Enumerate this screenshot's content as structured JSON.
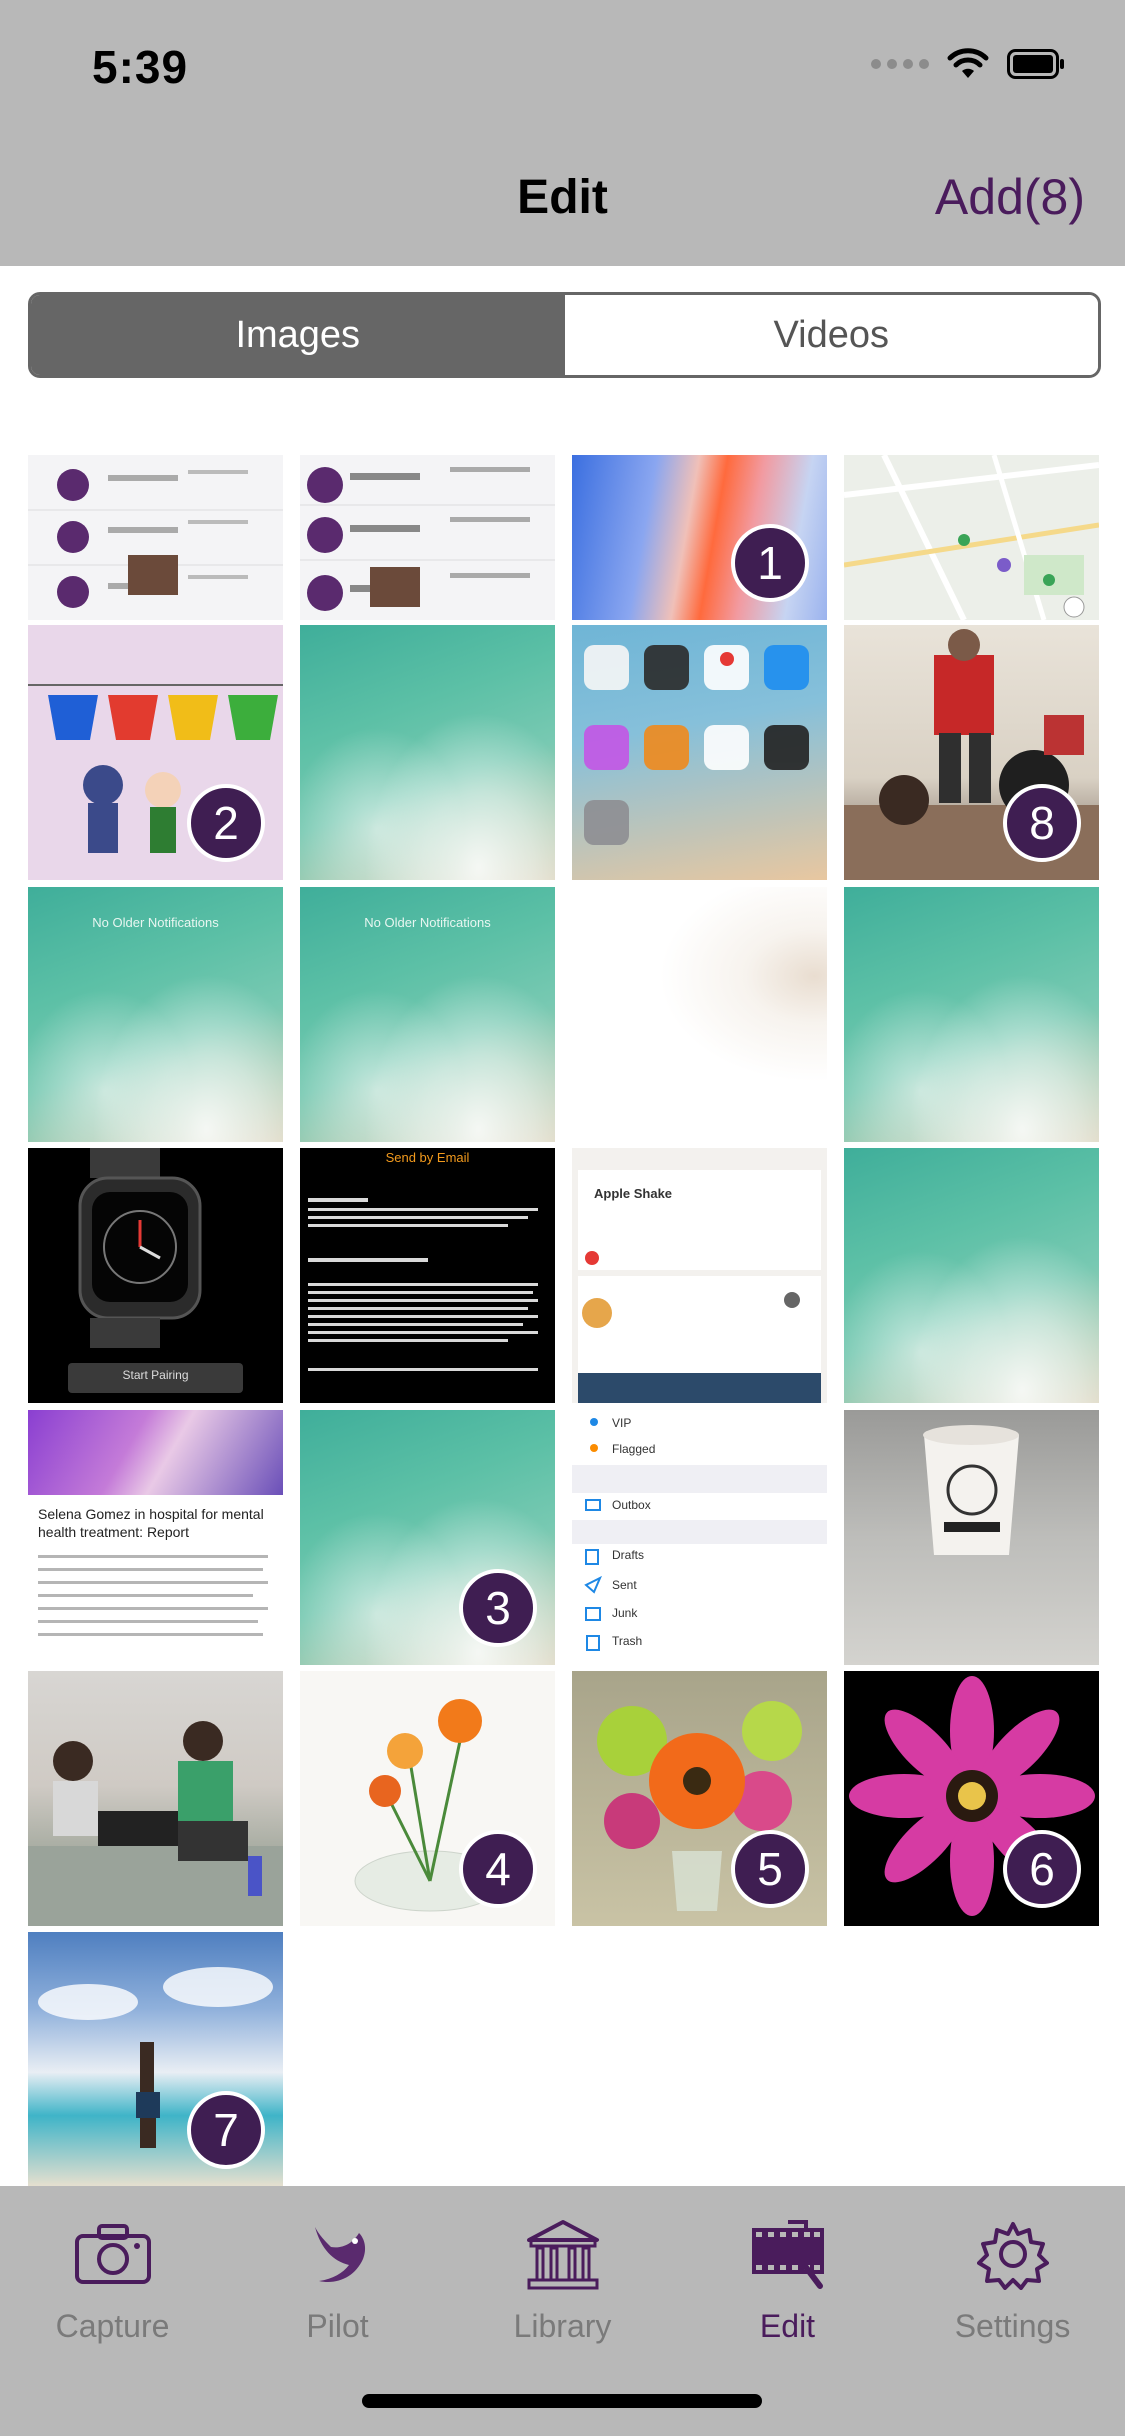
{
  "status": {
    "time": "5:39"
  },
  "nav": {
    "title": "Edit",
    "add_label": "Add(8)"
  },
  "segments": {
    "images": "Images",
    "videos": "Videos"
  },
  "grid": {
    "thumbs": [
      {
        "desc": "app-list-screenshot"
      },
      {
        "desc": "app-list-screenshot-2"
      },
      {
        "desc": "iphone-wallpaper",
        "badge": "1"
      },
      {
        "desc": "map-screenshot"
      },
      {
        "desc": "toys-and-cups",
        "badge": "2"
      },
      {
        "desc": "ocean-wallpaper"
      },
      {
        "desc": "home-screen"
      },
      {
        "desc": "office-people",
        "badge": "8"
      },
      {
        "desc": "ocean-notifications",
        "text": "No Older Notifications"
      },
      {
        "desc": "ocean-notifications-2",
        "text": "No Older Notifications"
      },
      {
        "desc": "blurred-white"
      },
      {
        "desc": "ocean-wallpaper-2"
      },
      {
        "desc": "apple-watch",
        "text": "Start Pairing"
      },
      {
        "desc": "watch-terms",
        "text": "Send by Email"
      },
      {
        "desc": "apple-shake",
        "text": "Apple Shake"
      },
      {
        "desc": "ocean-wallpaper-3"
      },
      {
        "desc": "news-article",
        "text": "Selena Gomez in hospital for mental health treatment: Report"
      },
      {
        "desc": "ocean-wallpaper-4",
        "badge": "3"
      },
      {
        "desc": "mail-folders",
        "items": [
          "VIP",
          "Flagged",
          "Outbox",
          "Drafts",
          "Sent",
          "Junk",
          "Trash"
        ]
      },
      {
        "desc": "coffee-cup"
      },
      {
        "desc": "people-laptops"
      },
      {
        "desc": "flower-vase",
        "badge": "4"
      },
      {
        "desc": "flower-bouquet",
        "badge": "5"
      },
      {
        "desc": "pink-flower",
        "badge": "6"
      },
      {
        "desc": "beach-handstand",
        "badge": "7"
      }
    ]
  },
  "tabs": [
    {
      "label": "Capture",
      "icon": "camera-icon"
    },
    {
      "label": "Pilot",
      "icon": "bird-icon"
    },
    {
      "label": "Library",
      "icon": "library-icon"
    },
    {
      "label": "Edit",
      "icon": "film-edit-icon",
      "active": true
    },
    {
      "label": "Settings",
      "icon": "gear-icon"
    }
  ],
  "colors": {
    "accent": "#4a1c5c",
    "badge": "#3f1e52",
    "bar_bg": "#b8b8b8",
    "segment_active": "#666666"
  }
}
